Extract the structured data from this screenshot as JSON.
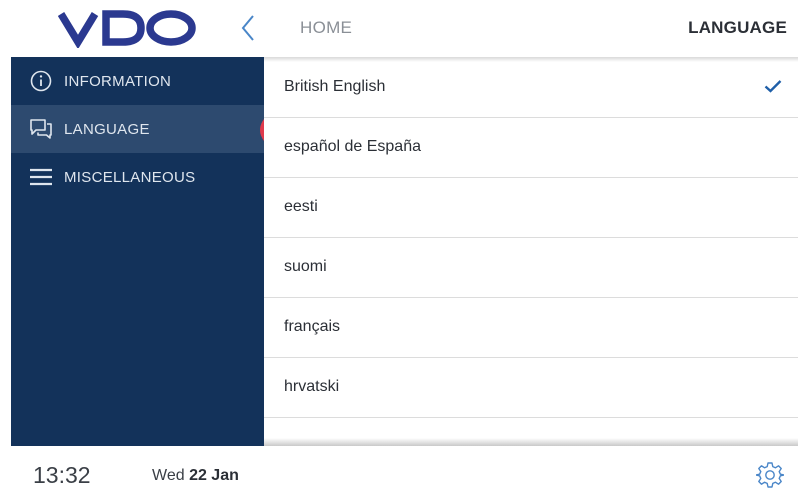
{
  "header": {
    "logo_text": "VDO",
    "breadcrumb_home": "HOME",
    "page_title": "LANGUAGE",
    "back_icon": "chevron-left-icon"
  },
  "sidebar": {
    "items": [
      {
        "label": "INFORMATION",
        "icon": "info-icon",
        "active": false
      },
      {
        "label": "LANGUAGE",
        "icon": "chat-bubbles-icon",
        "active": true
      },
      {
        "label": "MISCELLANEOUS",
        "icon": "menu-icon",
        "active": false
      }
    ]
  },
  "languages": {
    "items": [
      {
        "label": "British English",
        "selected": true
      },
      {
        "label": "español de España",
        "selected": false
      },
      {
        "label": "eesti",
        "selected": false
      },
      {
        "label": "suomi",
        "selected": false
      },
      {
        "label": "français",
        "selected": false
      },
      {
        "label": "hrvatski",
        "selected": false
      }
    ]
  },
  "footer": {
    "time": "13:32",
    "weekday": "Wed",
    "day_month": "22 Jan",
    "settings_icon": "gear-icon"
  },
  "colors": {
    "logo": "#2b3990",
    "sidebar_bg": "#13325a",
    "sidebar_active_bg": "#2d4a6f",
    "active_marker": "#e03a4c",
    "check": "#1f5fa8",
    "accent_blue": "#4a86c8"
  }
}
